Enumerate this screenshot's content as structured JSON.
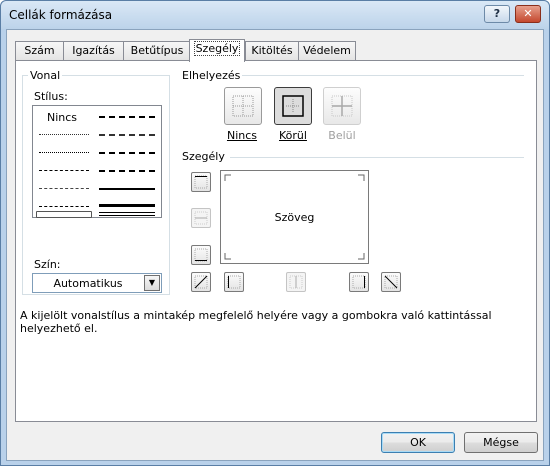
{
  "window": {
    "title": "Cellák formázása",
    "help_glyph": "?",
    "close_glyph": "✕"
  },
  "tabs": [
    {
      "label": "Szám"
    },
    {
      "label": "Igazítás"
    },
    {
      "label": "Betűtípus"
    },
    {
      "label": "Szegély",
      "active": true
    },
    {
      "label": "Kitöltés"
    },
    {
      "label": "Védelem"
    }
  ],
  "line": {
    "group_title": "Vonal",
    "style_label": "Stílus:",
    "none_label": "Nincs",
    "color_label": "Szín:",
    "color_value": "Automatikus"
  },
  "presets": {
    "title": "Elhelyezés",
    "items": [
      {
        "label": "Nincs",
        "icon": "border-none-icon"
      },
      {
        "label": "Körül",
        "icon": "border-outline-icon",
        "pressed": true
      },
      {
        "label": "Belül",
        "icon": "border-inside-icon",
        "disabled": true
      }
    ]
  },
  "border": {
    "title": "Szegély",
    "preview_text": "Szöveg",
    "buttons": [
      "top",
      "middle-horizontal",
      "bottom",
      "diagonal-up",
      "left",
      "middle-vertical",
      "right",
      "diagonal-down"
    ]
  },
  "hint": "A kijelölt vonalstílus a mintakép megfelelő helyére vagy a gombokra való kattintással helyezhető el.",
  "footer": {
    "ok_label": "OK",
    "cancel_label": "Mégse"
  },
  "colors": {
    "title_gradient_top": "#dae8f6",
    "frame": "#b9d1ea",
    "close": "#c4482e"
  }
}
